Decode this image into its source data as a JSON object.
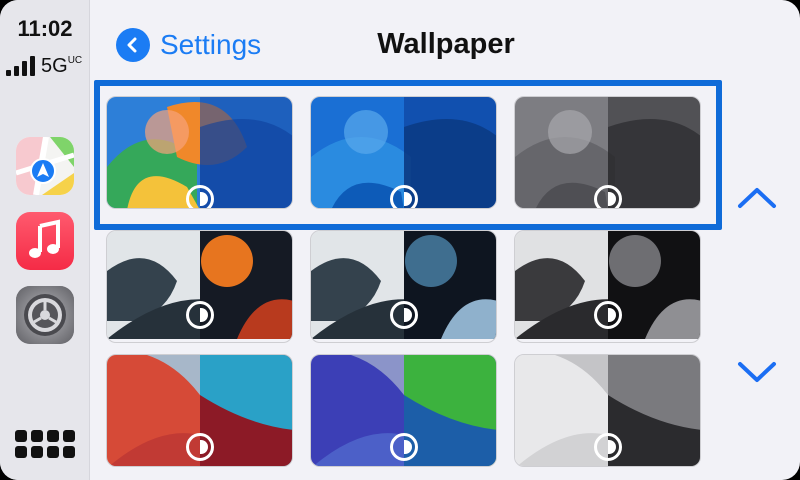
{
  "status": {
    "time": "11:02",
    "network": "5G",
    "network_suffix": "UC"
  },
  "dock": {
    "apps": [
      {
        "name": "Maps",
        "icon": "maps-icon"
      },
      {
        "name": "Music",
        "icon": "music-icon"
      },
      {
        "name": "Settings",
        "icon": "settings-icon"
      }
    ],
    "grid_icon": "app-grid-icon"
  },
  "header": {
    "back_label": "Settings",
    "title": "Wallpaper"
  },
  "colors": {
    "accent": "#1b7cf4",
    "highlight": "#0f6bd8"
  },
  "wallpapers": {
    "rows": [
      {
        "tiles": [
          {
            "theme": "colorful",
            "left": [
              "#2a7fd6",
              "#f08a2a"
            ],
            "right": [
              "#0e4aa8",
              "#1a3c8c"
            ]
          },
          {
            "theme": "blue",
            "left": [
              "#1e72d8",
              "#0c5bc4"
            ],
            "right": [
              "#0a3e98",
              "#0a2f7a"
            ]
          },
          {
            "theme": "gray",
            "left": [
              "#8a8a8e",
              "#5e5e62"
            ],
            "right": [
              "#4c4c50",
              "#2f2f33"
            ]
          }
        ]
      },
      {
        "tiles": [
          {
            "theme": "orange-red",
            "left": [
              "#dfe4e8",
              "#2f3d48"
            ],
            "right": [
              "#e36b1e",
              "#1a1f2a"
            ]
          },
          {
            "theme": "steel-blue",
            "left": [
              "#dfe4e8",
              "#2f3d48"
            ],
            "right": [
              "#4b7a9e",
              "#0f1722"
            ]
          },
          {
            "theme": "mono",
            "left": [
              "#dfe0e2",
              "#333"
            ],
            "right": [
              "#6a6a6e",
              "#111"
            ]
          }
        ]
      },
      {
        "tiles": [
          {
            "theme": "red-teal",
            "left": [
              "#d8503c",
              "#c23d38"
            ],
            "right": [
              "#2aa0c8",
              "#8a1a24"
            ]
          },
          {
            "theme": "purple-green",
            "left": [
              "#3d3fb8",
              "#4a5ec9"
            ],
            "right": [
              "#38b23c",
              "#1e5ea8"
            ]
          },
          {
            "theme": "silver",
            "left": [
              "#e9e9eb",
              "#cfcfd1"
            ],
            "right": [
              "#7a7a7e",
              "#2a2a2d"
            ]
          }
        ]
      }
    ]
  }
}
